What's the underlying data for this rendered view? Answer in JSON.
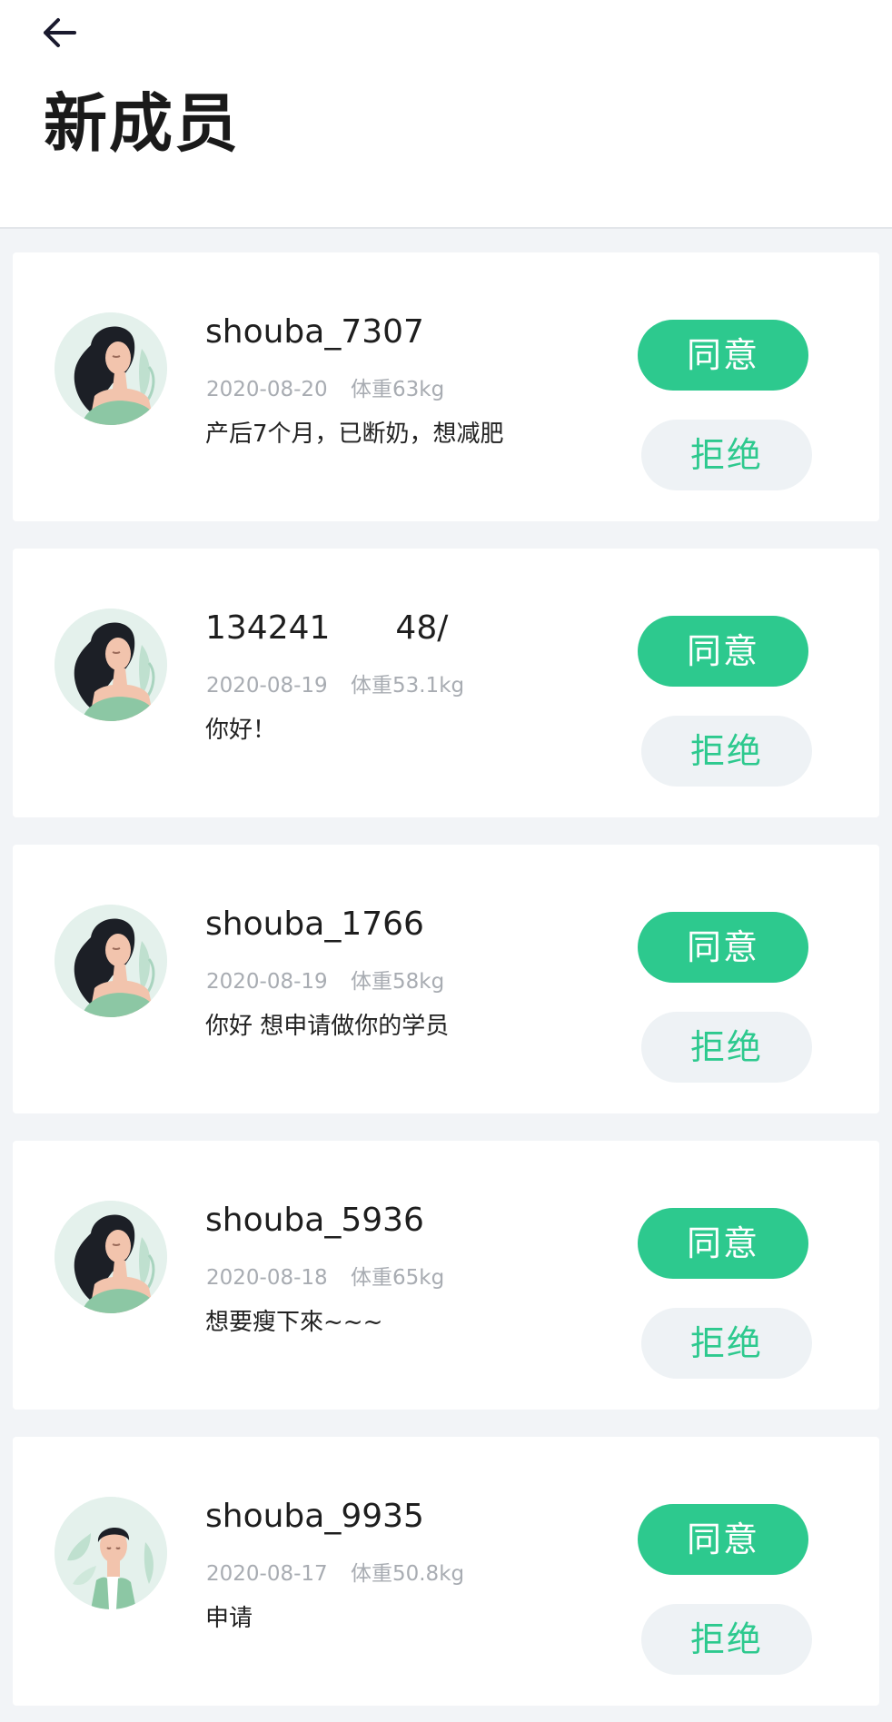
{
  "header": {
    "back_icon": "arrow-left-icon",
    "title": "新成员"
  },
  "colors": {
    "accent": "#2dc98e",
    "reject_bg": "#eef2f5",
    "meta_text": "#a8acb2",
    "page_bg": "#f2f4f7"
  },
  "members": [
    {
      "name": "shouba_7307",
      "date": "2020-08-20",
      "weight": "体重63kg",
      "note": "产后7个月，已断奶，想减肥",
      "avatar": "female-avatar",
      "agree_label": "同意",
      "reject_label": "拒绝"
    },
    {
      "name": "134241  48∕",
      "date": "2020-08-19",
      "weight": "体重53.1kg",
      "note": "你好！",
      "avatar": "female-avatar",
      "agree_label": "同意",
      "reject_label": "拒绝"
    },
    {
      "name": "shouba_1766",
      "date": "2020-08-19",
      "weight": "体重58kg",
      "note": "你好 想申请做你的学员",
      "avatar": "female-avatar",
      "agree_label": "同意",
      "reject_label": "拒绝"
    },
    {
      "name": "shouba_5936",
      "date": "2020-08-18",
      "weight": "体重65kg",
      "note": "想要瘦下來~~~",
      "avatar": "female-avatar",
      "agree_label": "同意",
      "reject_label": "拒绝"
    },
    {
      "name": "shouba_9935",
      "date": "2020-08-17",
      "weight": "体重50.8kg",
      "note": "申请",
      "avatar": "male-avatar",
      "agree_label": "同意",
      "reject_label": "拒绝"
    }
  ]
}
